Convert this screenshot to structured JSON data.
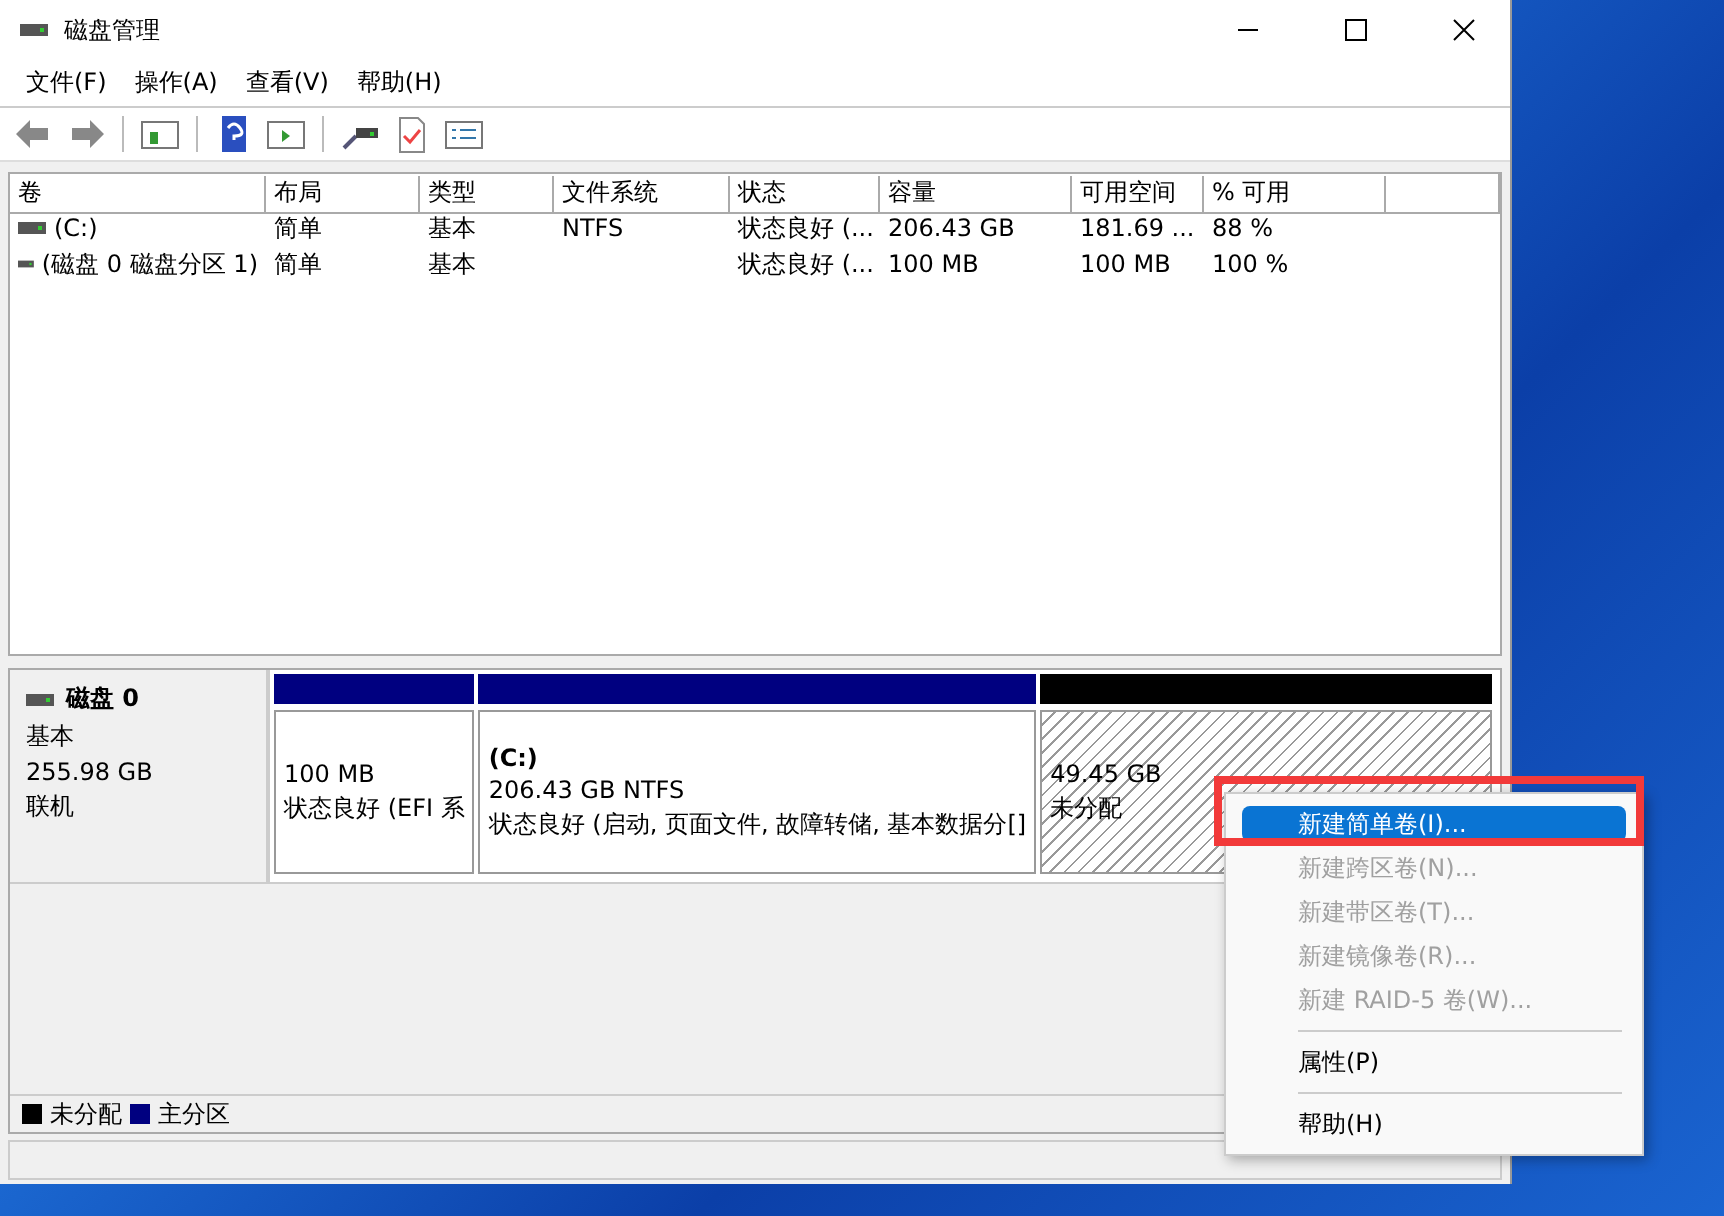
{
  "window": {
    "title": "磁盘管理"
  },
  "menu": [
    "文件(F)",
    "操作(A)",
    "查看(V)",
    "帮助(H)"
  ],
  "table": {
    "columns": [
      "卷",
      "布局",
      "类型",
      "文件系统",
      "状态",
      "容量",
      "可用空间",
      "% 可用"
    ],
    "rows": [
      {
        "cells": [
          "(C:)",
          "简单",
          "基本",
          "NTFS",
          "状态良好 (...",
          "206.43 GB",
          "181.69 ...",
          "88 %"
        ]
      },
      {
        "cells": [
          "(磁盘 0 磁盘分区 1)",
          "简单",
          "基本",
          "",
          "状态良好 (...",
          "100 MB",
          "100 MB",
          "100 %"
        ]
      }
    ]
  },
  "disk": {
    "name": "磁盘 0",
    "type": "基本",
    "size": "255.98 GB",
    "status": "联机",
    "partitions": [
      {
        "kind": "primary",
        "size": "100 MB",
        "status": "状态良好 (EFI 系"
      },
      {
        "kind": "primary",
        "title": "(C:)",
        "size": "206.43 GB NTFS",
        "status": "状态良好 (启动, 页面文件, 故障转储, 基本数据分[]"
      },
      {
        "kind": "unallocated",
        "size": "49.45 GB",
        "status": "未分配"
      }
    ]
  },
  "legend": [
    {
      "label": "未分配",
      "color": "#000000"
    },
    {
      "label": "主分区",
      "color": "#000080"
    }
  ],
  "context_menu": [
    {
      "kind": "item",
      "label": "新建简单卷(I)...",
      "selected": true,
      "disabled": false
    },
    {
      "kind": "item",
      "label": "新建跨区卷(N)...",
      "selected": false,
      "disabled": true
    },
    {
      "kind": "item",
      "label": "新建带区卷(T)...",
      "selected": false,
      "disabled": true
    },
    {
      "kind": "item",
      "label": "新建镜像卷(R)...",
      "selected": false,
      "disabled": true
    },
    {
      "kind": "item",
      "label": "新建 RAID-5 卷(W)...",
      "selected": false,
      "disabled": true
    },
    {
      "kind": "separator"
    },
    {
      "kind": "item",
      "label": "属性(P)",
      "selected": false,
      "disabled": false
    },
    {
      "kind": "separator"
    },
    {
      "kind": "item",
      "label": "帮助(H)",
      "selected": false,
      "disabled": false
    }
  ]
}
